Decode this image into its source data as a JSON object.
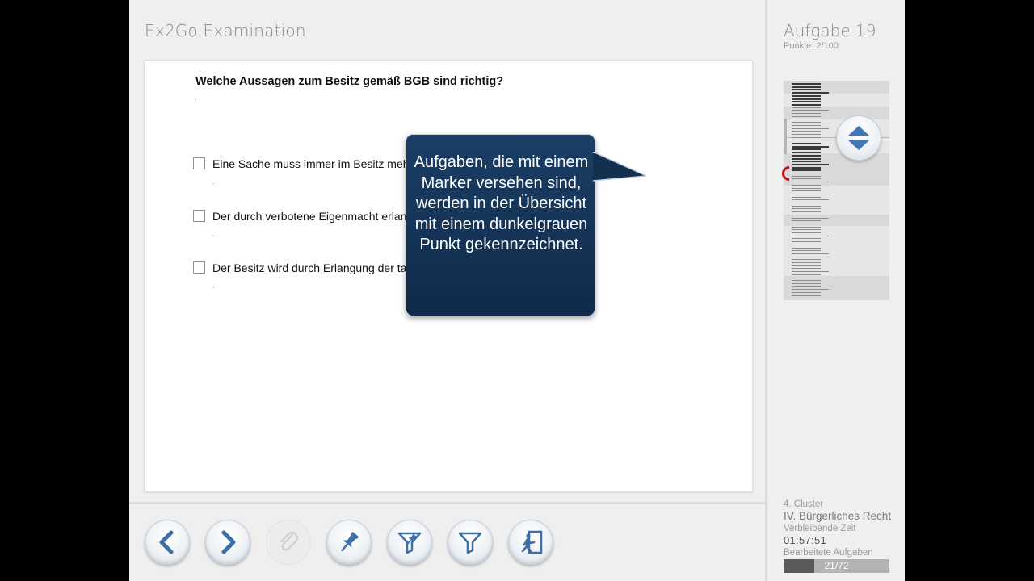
{
  "app": {
    "title": "Ex2Go Examination"
  },
  "question": {
    "text": "Welche Aussagen zum Besitz gemäß BGB sind richtig?",
    "answers": [
      {
        "label": "Eine Sache muss immer im Besitz mehrerer Personen sein",
        "checked": false
      },
      {
        "label": "Der durch verbotene Eigenmacht erlangte Besitz ist immer feh",
        "checked": false
      },
      {
        "label": "Der Besitz wird durch Erlangung der tatsächlichen Gewalt übe",
        "checked": false
      }
    ]
  },
  "toolbar": {
    "buttons": [
      {
        "name": "back-button",
        "icon": "chevron-left-icon",
        "enabled": true
      },
      {
        "name": "forward-button",
        "icon": "chevron-right-icon",
        "enabled": true
      },
      {
        "name": "attachment-button",
        "icon": "paperclip-icon",
        "enabled": false
      },
      {
        "name": "marker-button",
        "icon": "pushpin-icon",
        "enabled": true
      },
      {
        "name": "filter-marked-button",
        "icon": "filter-pin-icon",
        "enabled": true
      },
      {
        "name": "filter-button",
        "icon": "filter-icon",
        "enabled": true
      },
      {
        "name": "exit-button",
        "icon": "exit-icon",
        "enabled": true
      }
    ]
  },
  "panel": {
    "title": "Aufgabe 19",
    "points": "Punkte: 2/100",
    "cluster_label": "4. Cluster",
    "cluster_name": "IV. Bürgerliches Recht",
    "time_label": "Verbleibende Zeit",
    "time_value": "01:57:51",
    "progress_label": "Bearbeitete Aufgaben",
    "progress_text": "21/72",
    "progress_done": 21,
    "progress_total": 72
  },
  "callout": {
    "text": "Aufgaben, die mit einem Marker versehen sind, werden in der Übersicht mit einem dunkelgrauen Punkt gekennzeichnet."
  },
  "colors": {
    "callout_bg": "#163659",
    "marker_ring": "#b8141a",
    "accent_icon": "#3f6fa8"
  }
}
